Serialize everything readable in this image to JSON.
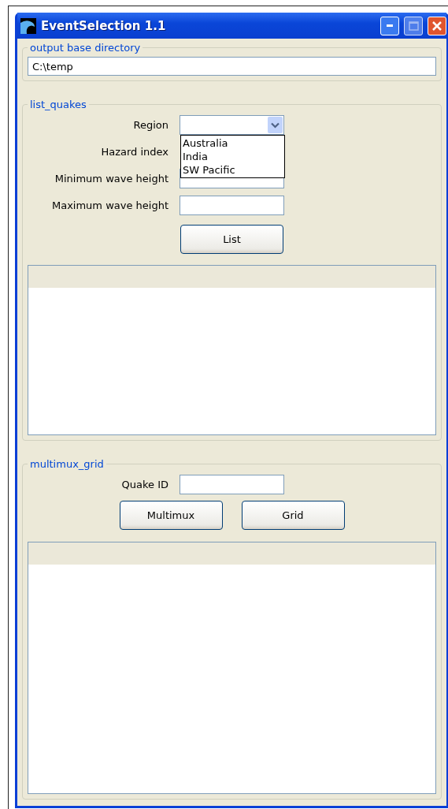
{
  "window": {
    "title": "EventSelection 1.1"
  },
  "output_base_directory": {
    "legend": "output base directory",
    "value": "C:\\temp"
  },
  "list_quakes": {
    "legend": "list_quakes",
    "region": {
      "label": "Region",
      "expanded": true,
      "options": [
        "Australia",
        "India",
        "SW Pacific"
      ]
    },
    "rows": [
      {
        "label": "Hazard index",
        "kind": "covered"
      },
      {
        "label": "Minimum wave height",
        "kind": "field"
      },
      {
        "label": "Maximum wave height",
        "kind": "field"
      }
    ],
    "button": "List"
  },
  "multimux_grid": {
    "legend": "multimux_grid",
    "quake_id_label": "Quake ID",
    "buttons": [
      "Multimux",
      "Grid"
    ]
  }
}
